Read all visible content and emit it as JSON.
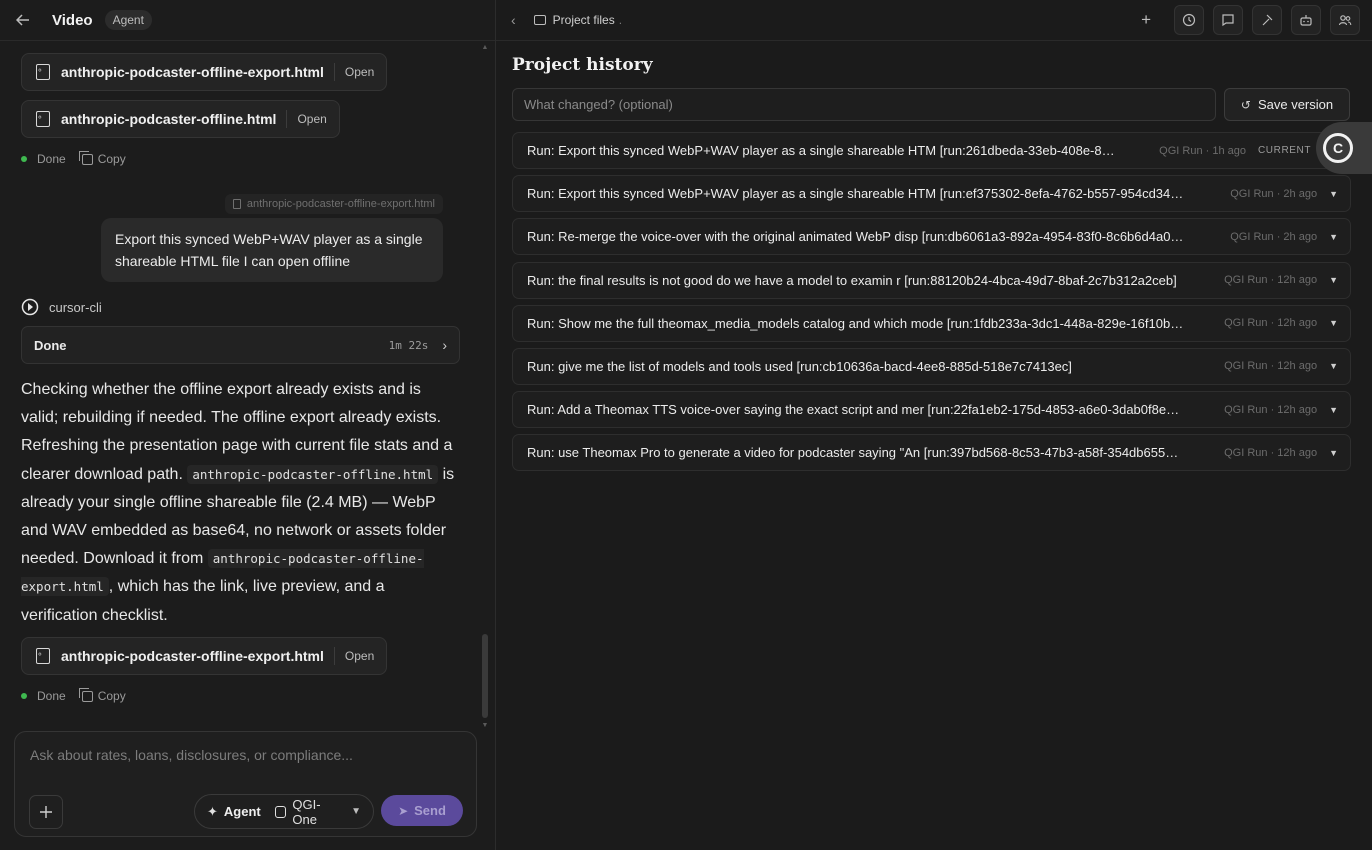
{
  "left": {
    "header": {
      "title": "Video",
      "badge": "Agent"
    },
    "files": [
      {
        "name": "anthropic-podcaster-offline-export.html",
        "action": "Open"
      },
      {
        "name": "anthropic-podcaster-offline.html",
        "action": "Open"
      },
      {
        "name": "anthropic-podcaster-offline-export.html",
        "action": "Open"
      }
    ],
    "status": {
      "done": "Done",
      "copy": "Copy"
    },
    "attachment": "anthropic-podcaster-offline-export.html",
    "user_message": "Export this synced WebP+WAV player as a single shareable HTML file I can open offline",
    "agent_name": "cursor-cli",
    "run_box": {
      "label": "Done",
      "duration": "1m 22s"
    },
    "reply": {
      "p1": "Checking whether the offline export already exists and is valid; rebuilding if needed. The offline export already exists. Refreshing the presentation page with current file stats and a clearer download path. ",
      "code1": "anthropic-podcaster-offline.html",
      "p2": " is already your single offline shareable file (2.4 MB) — WebP and WAV embedded as base64, no network or assets folder needed. Download it from ",
      "code2": "anthropic-podcaster-offline-export.html",
      "p3": ", which has the link, live preview, and a verification checklist."
    },
    "composer": {
      "placeholder": "Ask about rates, loans, disclosures, or compliance...",
      "mode": "Agent",
      "model": "QGI-One",
      "send": "Send"
    }
  },
  "right": {
    "header": {
      "title": "Project files",
      "dot": "."
    },
    "history_title": "Project history",
    "change_placeholder": "What changed? (optional)",
    "save_label": "Save version",
    "current_label": "CURRENT",
    "runs": [
      {
        "text": "Run: Export this synced WebP+WAV player as a single shareable HTM [run:261dbeda-33eb-408e-8…",
        "meta": "QGI Run · 1h ago"
      },
      {
        "text": "Run: Export this synced WebP+WAV player as a single shareable HTM [run:ef375302-8efa-4762-b557-954cd34…",
        "meta": "QGI Run · 2h ago"
      },
      {
        "text": "Run: Re-merge the voice-over with the original animated WebP disp [run:db6061a3-892a-4954-83f0-8c6b6d4a0…",
        "meta": "QGI Run · 2h ago"
      },
      {
        "text": "Run: the final results is not good do we have a model to examin r [run:88120b24-4bca-49d7-8baf-2c7b312a2ceb]",
        "meta": "QGI Run · 12h ago"
      },
      {
        "text": "Run: Show me the full theomax_media_models catalog and which mode [run:1fdb233a-3dc1-448a-829e-16f10b…",
        "meta": "QGI Run · 12h ago"
      },
      {
        "text": "Run: give me the list of models and tools used [run:cb10636a-bacd-4ee8-885d-518e7c7413ec]",
        "meta": "QGI Run · 12h ago"
      },
      {
        "text": "Run: Add a Theomax TTS voice-over saying the exact script and mer [run:22fa1eb2-175d-4853-a6e0-3dab0f8e…",
        "meta": "QGI Run · 12h ago"
      },
      {
        "text": "Run: use Theomax Pro to generate a video for podcaster saying \"An [run:397bd568-8c53-47b3-a58f-354db655…",
        "meta": "QGI Run · 12h ago"
      }
    ]
  },
  "colors": {
    "accent_send": "#5b4a9c",
    "done_dot": "#3fb950"
  }
}
